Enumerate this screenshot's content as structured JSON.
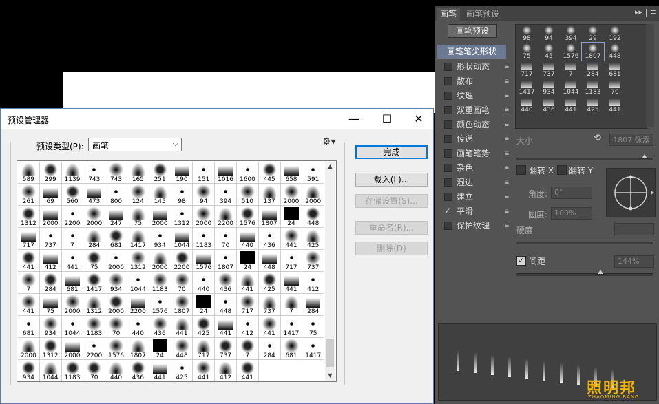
{
  "dialog": {
    "title": "预设管理器",
    "type_label": "预设类型(P):",
    "type_value": "画笔",
    "buttons": {
      "done": "完成",
      "load": "载入(L)...",
      "save": "存储设置(S)...",
      "rename": "重命名(R)...",
      "delete": "删除(D)"
    },
    "window_controls": {
      "minimize": "—",
      "maximize": "☐",
      "close": "✕"
    },
    "brush_sizes": [
      "589",
      "299",
      "1139",
      "743",
      "743",
      "165",
      "251",
      "190",
      "151",
      "1016",
      "1600",
      "445",
      "658",
      "591",
      "261",
      "69",
      "560",
      "473",
      "800",
      "124",
      "145",
      "98",
      "94",
      "394",
      "510",
      "137",
      "2000",
      "2000",
      "1312",
      "2000",
      "2200",
      "2000",
      "247",
      "75",
      "2000",
      "1312",
      "2000",
      "2200",
      "1576",
      "1807",
      "24",
      "448",
      "717",
      "737",
      "7",
      "284",
      "681",
      "1417",
      "934",
      "1044",
      "1183",
      "70",
      "440",
      "436",
      "441",
      "425",
      "441",
      "412",
      "441",
      "75",
      "2000",
      "1312",
      "2000",
      "2200",
      "1576",
      "1807",
      "24",
      "448",
      "717",
      "737",
      "7",
      "284",
      "681",
      "1417",
      "934",
      "1044",
      "1183",
      "70",
      "440",
      "436",
      "441",
      "425",
      "441",
      "412",
      "441",
      "75",
      "2000",
      "1312",
      "2000",
      "2200",
      "1576",
      "1807",
      "24",
      "448",
      "717",
      "737",
      "7",
      "284",
      "681",
      "934",
      "1044",
      "1183",
      "70",
      "440",
      "436",
      "441",
      "425",
      "441",
      "412",
      "441",
      "1417",
      "75",
      "2000",
      "1312",
      "2000",
      "2200",
      "1576",
      "1807",
      "24",
      "448",
      "717",
      "737",
      "7",
      "284",
      "681",
      "1417",
      "934",
      "1044",
      "1183",
      "70",
      "440",
      "436",
      "441",
      "425",
      "441",
      "412",
      "441"
    ]
  },
  "panel": {
    "tabs": [
      "画笔",
      "画笔预设"
    ],
    "tab_menu": "▸▸ | ≡",
    "preset_button": "画笔预设",
    "tip_shape": "画笔笔尖形状",
    "options": [
      {
        "label": "形状动态",
        "checked": false
      },
      {
        "label": "散布",
        "checked": false
      },
      {
        "label": "纹理",
        "checked": false
      },
      {
        "label": "双重画笔",
        "checked": false
      },
      {
        "label": "颜色动态",
        "checked": false
      },
      {
        "label": "传递",
        "checked": false
      },
      {
        "label": "画笔笔势",
        "checked": false
      },
      {
        "label": "杂色",
        "checked": false
      },
      {
        "label": "湿边",
        "checked": false
      },
      {
        "label": "建立",
        "checked": false
      },
      {
        "label": "平滑",
        "checked": true
      },
      {
        "label": "保护纹理",
        "checked": false
      }
    ],
    "brush_grid": [
      "98",
      "94",
      "394",
      "29",
      "192",
      "75",
      "45",
      "1576",
      "1807",
      "448",
      "717",
      "737",
      "7",
      "284",
      "681",
      "1417",
      "934",
      "1044",
      "1183",
      "70",
      "440",
      "436",
      "441",
      "425",
      "441"
    ],
    "size_label": "大小",
    "size_value": "1807 像素",
    "flip_x": "翻转 X",
    "flip_y": "翻转 Y",
    "angle_label": "角度:",
    "angle_value": "0°",
    "roundness_label": "圆度:",
    "roundness_value": "100%",
    "hardness_label": "硬度",
    "spacing_label": "间距",
    "spacing_value": "144%",
    "watermark": "照明邦",
    "watermark_sub": "ZHAOMING BANG"
  }
}
